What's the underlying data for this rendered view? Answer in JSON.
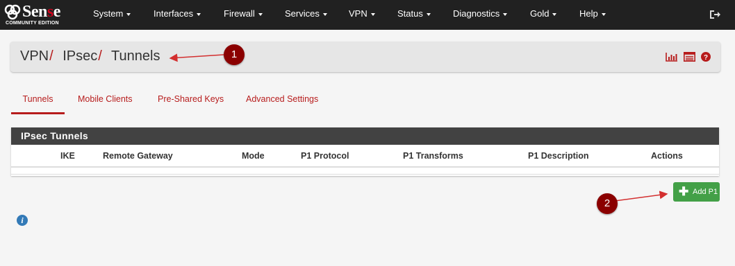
{
  "navbar": {
    "logo_brand_pre": "Sen",
    "logo_brand_accent": "s",
    "logo_brand_post": "e",
    "logo_edition": "COMMUNITY EDITION",
    "menu": [
      {
        "label": "System"
      },
      {
        "label": "Interfaces"
      },
      {
        "label": "Firewall"
      },
      {
        "label": "Services"
      },
      {
        "label": "VPN"
      },
      {
        "label": "Status"
      },
      {
        "label": "Diagnostics"
      },
      {
        "label": "Gold"
      },
      {
        "label": "Help"
      }
    ],
    "logout_icon": "sign-out-icon"
  },
  "breadcrumb": {
    "items": [
      "VPN",
      "IPsec",
      "Tunnels"
    ],
    "separator": "/",
    "icons": [
      "bar-chart-icon",
      "log-table-icon",
      "help-circle-icon"
    ]
  },
  "tabs": [
    {
      "label": "Tunnels",
      "active": true
    },
    {
      "label": "Mobile Clients",
      "active": false
    },
    {
      "label": "Pre-Shared Keys",
      "active": false
    },
    {
      "label": "Advanced Settings",
      "active": false
    }
  ],
  "panel": {
    "title": "IPsec Tunnels",
    "columns": [
      "IKE",
      "Remote Gateway",
      "Mode",
      "P1 Protocol",
      "P1 Transforms",
      "P1 Description",
      "Actions"
    ],
    "rows": []
  },
  "actions": {
    "add_label": "Add P1",
    "add_icon": "plus-icon",
    "info_icon": "info-circle-icon"
  },
  "annotations": [
    {
      "number": "1"
    },
    {
      "number": "2"
    }
  ],
  "colors": {
    "navbar_bg": "#212121",
    "accent_red": "#b71c1c",
    "panel_heading_bg": "#424242",
    "success_green": "#43a047",
    "marker_bg": "#8b0000"
  }
}
